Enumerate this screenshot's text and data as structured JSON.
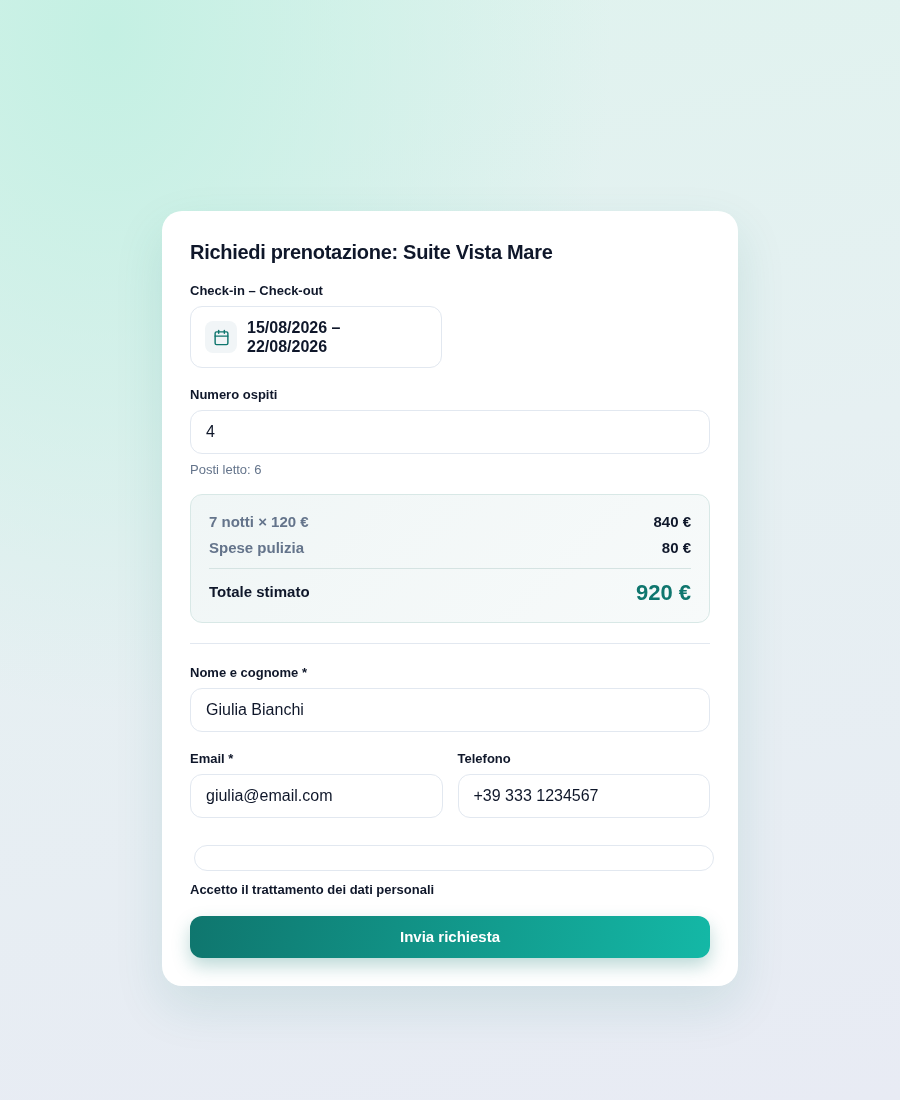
{
  "title": "Richiedi prenotazione: Suite Vista Mare",
  "dates": {
    "label": "Check-in – Check-out",
    "value": "15/08/2026 – 22/08/2026"
  },
  "guests": {
    "label": "Numero ospiti",
    "value": "4",
    "hint": "Posti letto: 6"
  },
  "summary": {
    "lines": [
      {
        "label": "7 notti × 120 €",
        "amount": "840 €"
      },
      {
        "label": "Spese pulizia",
        "amount": "80 €"
      }
    ],
    "total": {
      "label": "Totale stimato",
      "amount": "920 €"
    }
  },
  "name_field": {
    "label": "Nome e cognome *",
    "value": "Giulia Bianchi"
  },
  "contact_fields": [
    {
      "label": "Email *",
      "value": "giulia@email.com"
    },
    {
      "label": "Telefono",
      "value": "+39 333 1234567"
    }
  ],
  "consent": {
    "label": "Accetto il trattamento dei dati personali",
    "checked": false
  },
  "submit": {
    "label": "Invia richiesta"
  }
}
